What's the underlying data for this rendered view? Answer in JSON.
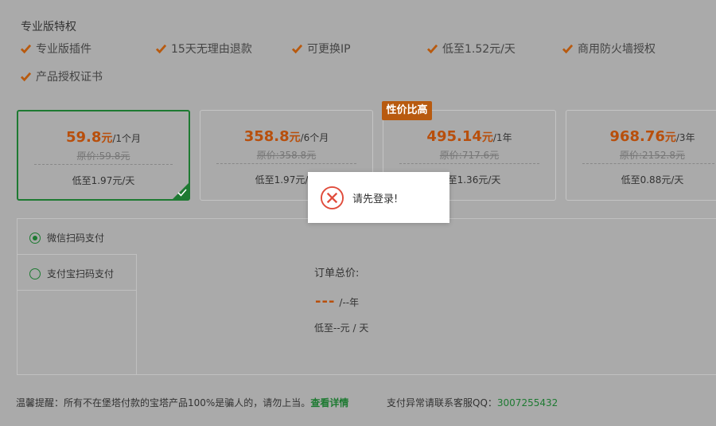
{
  "features": {
    "title": "专业版特权",
    "items": [
      "专业版插件",
      "15天无理由退款",
      "可更换IP",
      "低至1.52元/天",
      "商用防火墙授权",
      "产品授权证书"
    ]
  },
  "plans": [
    {
      "price": "59.8",
      "unit": "元",
      "period": "/1个月",
      "original": "原价:59.8元",
      "daily": "低至1.97元/天",
      "selected": true
    },
    {
      "price": "358.8",
      "unit": "元",
      "period": "/6个月",
      "original": "原价:358.8元",
      "daily": "低至1.97元/天",
      "selected": false
    },
    {
      "price": "495.14",
      "unit": "元",
      "period": "/1年",
      "original": "原价:717.6元",
      "daily": "低至1.36元/天",
      "selected": false
    },
    {
      "price": "968.76",
      "unit": "元",
      "period": "/3年",
      "original": "原价:2152.8元",
      "daily": "低至0.88元/天",
      "selected": false
    }
  ],
  "badge": "性价比高",
  "payment": {
    "wechat": "微信扫码支付",
    "alipay": "支付宝扫码支付",
    "order_label": "订单总价:",
    "order_price": "---",
    "order_period": "/--年",
    "order_daily": "低至--元 / 天"
  },
  "footer": {
    "tip": "温馨提醒：所有不在堡塔付款的宝塔产品100%是骗人的，请勿上当。",
    "details_link": "查看详情",
    "support": "支付异常请联系客服QQ：",
    "qq": "3007255432"
  },
  "modal": {
    "message": "请先登录!"
  },
  "colors": {
    "accent_orange": "#b84f0c",
    "accent_green": "#1e7a32",
    "error_red": "#e04c3c"
  }
}
